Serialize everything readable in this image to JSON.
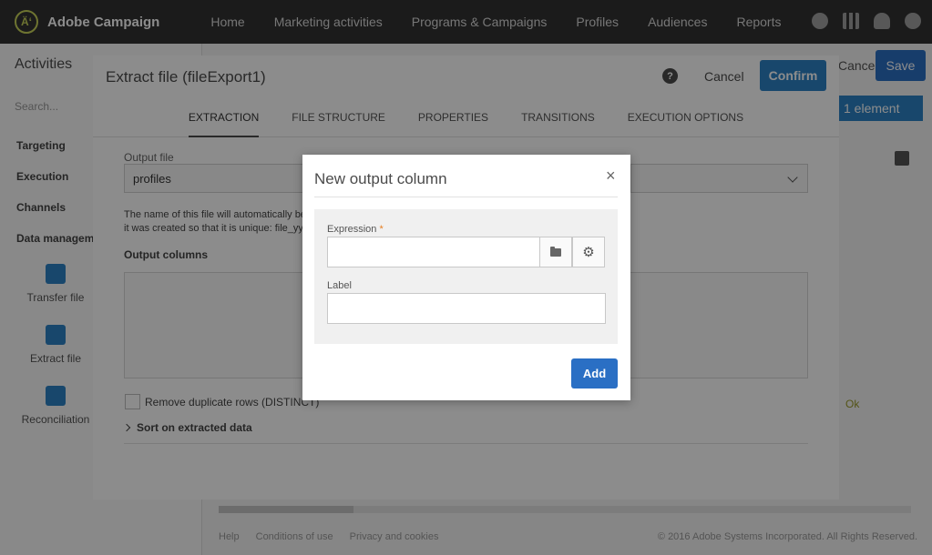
{
  "app": {
    "brand": "Adobe Campaign",
    "logo_glyph": "Ä‘",
    "nav": [
      "Home",
      "Marketing activities",
      "Programs & Campaigns",
      "Profiles",
      "Audiences",
      "Reports"
    ]
  },
  "background": {
    "activities_title": "Activities",
    "search_placeholder": "Search...",
    "categories": [
      "Targeting",
      "Execution",
      "Channels",
      "Data management"
    ],
    "tools": [
      "Transfer file",
      "Extract file",
      "Reconciliation"
    ],
    "save_label": "Save",
    "cancel_label": "Cancel",
    "selection_badge": "1 element",
    "transition_label": "Ok",
    "footer_links": [
      "Help",
      "Conditions of use",
      "Privacy and cookies"
    ],
    "copyright": "© 2016 Adobe Systems Incorporated. All Rights Reserved."
  },
  "panel": {
    "title": "Extract file (fileExport1)",
    "help_glyph": "?",
    "cancel_label": "Cancel",
    "confirm_label": "Confirm",
    "tabs": [
      "EXTRACTION",
      "FILE STRUCTURE",
      "PROPERTIES",
      "TRANSITIONS",
      "EXECUTION OPTIONS"
    ],
    "active_tab": "EXTRACTION",
    "output_file_label": "Output file",
    "output_file_value": "profiles",
    "info_line1": "The name of this file will automatically be",
    "info_line2": "it was created so that it is unique: file_yyy",
    "output_columns_label": "Output columns",
    "remove_duplicates_label": "Remove duplicate rows (DISTINCT)",
    "sort_label": "Sort on extracted data"
  },
  "dialog": {
    "title": "New output column",
    "close_glyph": "×",
    "expression_label": "Expression",
    "required_mark": "*",
    "expression_value": "",
    "label_label": "Label",
    "label_value": "",
    "gear_glyph": "⚙",
    "add_label": "Add"
  }
}
